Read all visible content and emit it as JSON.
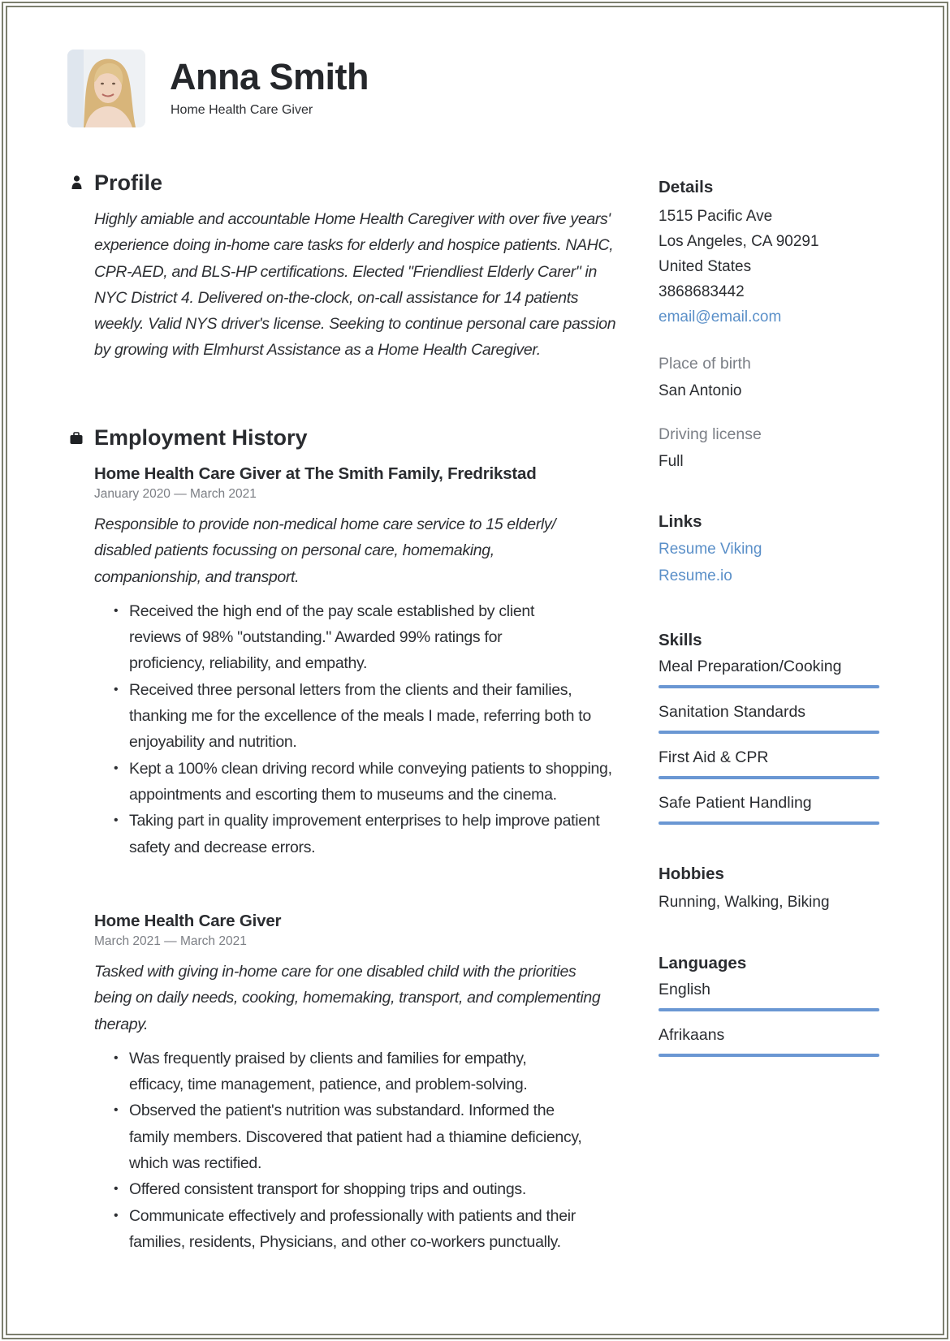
{
  "header": {
    "name": "Anna Smith",
    "title": "Home Health Care Giver",
    "photo_alt": "Profile photo"
  },
  "profile": {
    "heading": "Profile",
    "icon": "person-icon",
    "summary": "Highly amiable and accountable Home Health Caregiver with over five years' experience doing in-home care tasks for elderly and hospice patients. NAHC, CPR-AED, and BLS-HP certifications. Elected \"Friendliest Elderly Carer\" in NYC District 4. Delivered on-the-clock, on-call assistance for 14 patients weekly. Valid NYS driver's license. Seeking to continue personal care passion by growing with Elmhurst Assistance as a Home Health Caregiver."
  },
  "employment": {
    "heading": "Employment History",
    "icon": "briefcase-icon",
    "jobs": [
      {
        "title": "Home Health Care Giver at The Smith Family, Fredrikstad",
        "dates": "January 2020 — March 2021",
        "description": "Responsible to provide non-medical home care service to 15 elderly/ disabled patients focussing on personal care, homemaking, companionship, and transport.",
        "bullets": [
          "Received the high end of the pay scale established by client reviews of 98% \"outstanding.\" Awarded 99% ratings for proficiency, reliability, and empathy.",
          "Received three personal letters from the clients and their families, thanking me for the excellence of the meals I made, referring both to enjoyability and nutrition.",
          "Kept a 100% clean driving record while conveying patients to shopping, appointments and escorting them to museums and the cinema.",
          "Taking part in quality improvement enterprises to help improve patient safety and decrease errors."
        ]
      },
      {
        "title": "Home Health Care Giver",
        "dates": "March 2021 — March 2021",
        "description": "Tasked with giving in-home care for one disabled child with the priorities being on daily needs, cooking, homemaking, transport, and complementing therapy.",
        "bullets": [
          "Was frequently praised by clients and families for empathy, efficacy, time management, patience, and problem-solving.",
          "Observed the patient's nutrition was substandard. Informed the family members. Discovered that patient had a thiamine deficiency, which was rectified.",
          "Offered consistent transport for shopping trips and outings.",
          "Communicate effectively and professionally with patients and their families, residents, Physicians, and other co-workers punctually."
        ]
      }
    ]
  },
  "sidebar": {
    "details": {
      "heading": "Details",
      "address_line1": "1515 Pacific Ave",
      "address_line2": "Los Angeles, CA 90291",
      "country": "United States",
      "phone": "3868683442",
      "email": "email@email.com"
    },
    "place_of_birth": {
      "label": "Place of birth",
      "value": "San Antonio"
    },
    "driving_license": {
      "label": "Driving license",
      "value": "Full"
    },
    "links": {
      "heading": "Links",
      "items": [
        "Resume Viking",
        "Resume.io"
      ]
    },
    "skills": {
      "heading": "Skills",
      "items": [
        {
          "name": "Meal Preparation/Cooking",
          "level": 1.0
        },
        {
          "name": "Sanitation Standards",
          "level": 1.0
        },
        {
          "name": "First Aid & CPR",
          "level": 1.0
        },
        {
          "name": "Safe Patient Handling",
          "level": 1.0
        }
      ]
    },
    "hobbies": {
      "heading": "Hobbies",
      "value": "Running, Walking, Biking"
    },
    "languages": {
      "heading": "Languages",
      "items": [
        {
          "name": "English",
          "level": 1.0
        },
        {
          "name": "Afrikaans",
          "level": 1.0
        }
      ]
    }
  },
  "colors": {
    "accent": "#6a97d3",
    "link": "#5a8fc8",
    "muted": "#7b7f86",
    "text": "#2a2c30",
    "frame": "#7c7f6e"
  }
}
